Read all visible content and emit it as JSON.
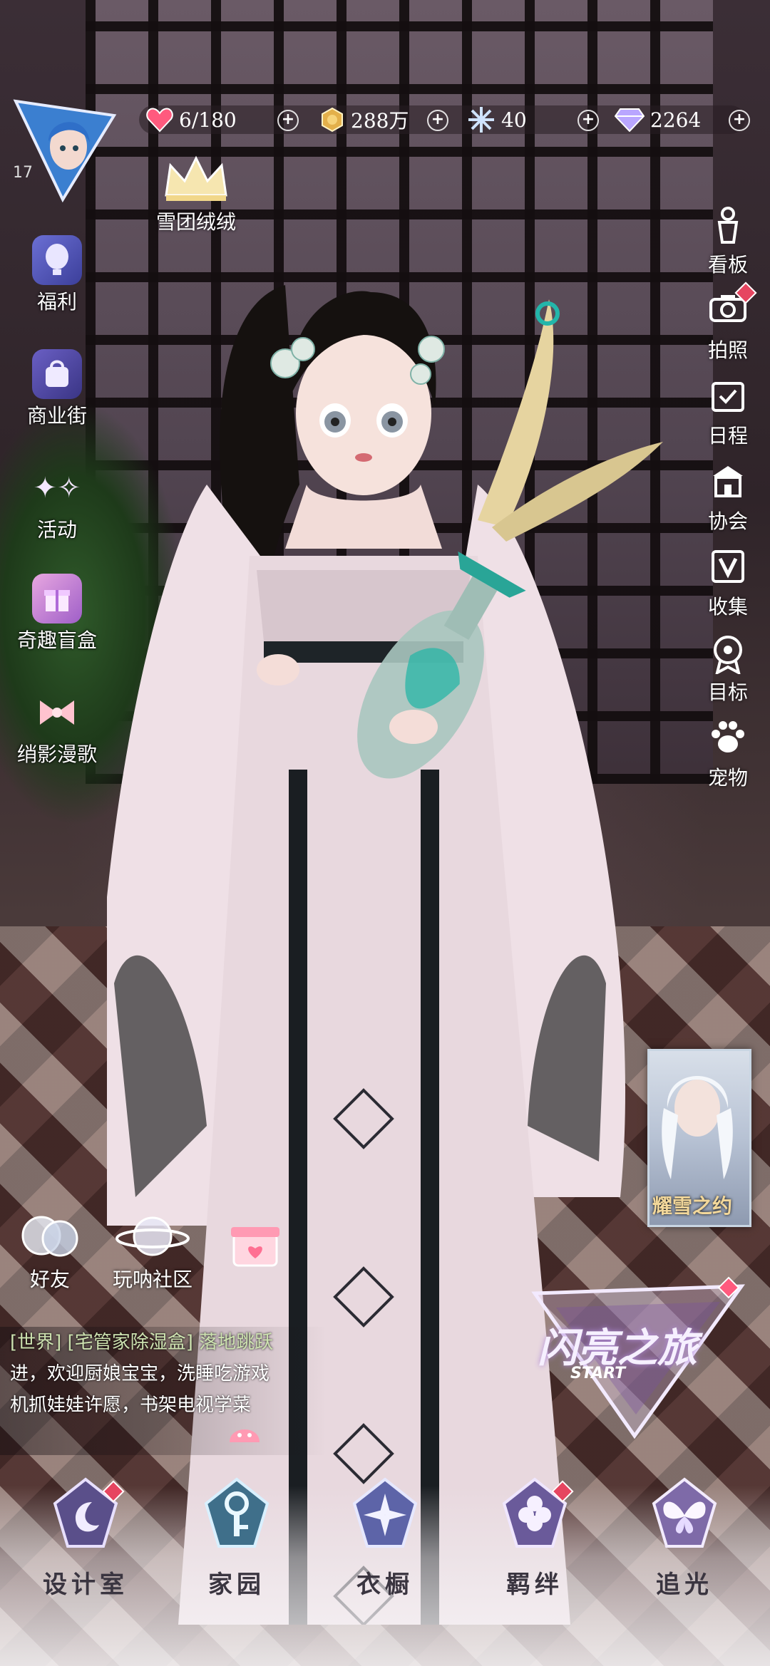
{
  "resources": [
    {
      "icon": "heart-stamina-icon",
      "value": "6/180",
      "color": "#ff5a7e"
    },
    {
      "icon": "gold-coin-icon",
      "value": "288万",
      "color": "#e3b04b"
    },
    {
      "icon": "snowflake-icon",
      "value": "40",
      "color": "#cfe3ff"
    },
    {
      "icon": "diamond-icon",
      "value": "2264",
      "color": "#b9a6ff"
    }
  ],
  "player": {
    "level": "17",
    "title": "雪团绒绒"
  },
  "left_menu": [
    {
      "label": "福利",
      "icon": "balloon-icon"
    },
    {
      "label": "商业街",
      "icon": "shopping-bag-icon"
    },
    {
      "label": "活动",
      "icon": "stars-icon"
    },
    {
      "label": "奇趣盲盒",
      "icon": "gift-box-icon"
    },
    {
      "label": "绡影漫歌",
      "icon": "bow-icon"
    }
  ],
  "right_menu": [
    {
      "label": "看板",
      "icon": "mannequin-icon"
    },
    {
      "label": "拍照",
      "icon": "camera-icon"
    },
    {
      "label": "日程",
      "icon": "calendar-icon"
    },
    {
      "label": "协会",
      "icon": "building-icon"
    },
    {
      "label": "收集",
      "icon": "collection-icon"
    },
    {
      "label": "目标",
      "icon": "medal-icon"
    },
    {
      "label": "宠物",
      "icon": "paw-icon"
    }
  ],
  "event_card": {
    "text": "耀雪之约"
  },
  "social": [
    {
      "label": "好友",
      "icon": "friends-icon"
    },
    {
      "label": "玩呐社区",
      "icon": "planet-icon"
    }
  ],
  "chat": {
    "line1": "[世界] [宅管家除湿盒] 落地跳跃",
    "line2": "进，欢迎厨娘宝宝，洗睡吃游戏",
    "line3": "机抓娃娃许愿，书架电视学菜"
  },
  "start_banner": {
    "title": "闪亮之旅",
    "sub": "START"
  },
  "bottom_nav": [
    {
      "label": "设计室",
      "icon": "moon-pen-icon"
    },
    {
      "label": "家园",
      "icon": "key-icon"
    },
    {
      "label": "衣橱",
      "icon": "crystal-flower-icon"
    },
    {
      "label": "羁绊",
      "icon": "clover-icon"
    },
    {
      "label": "追光",
      "icon": "butterfly-icon"
    }
  ]
}
